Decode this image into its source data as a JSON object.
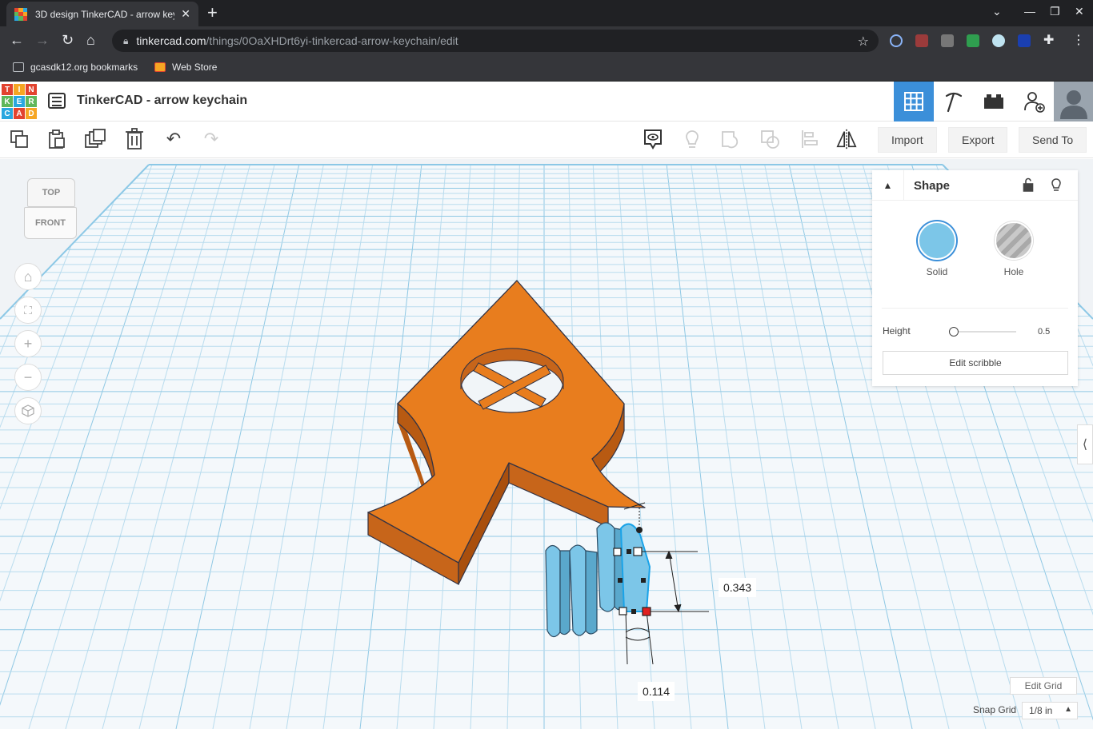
{
  "browser": {
    "tab_title": "3D design TinkerCAD - arrow key",
    "url_host": "tinkercad.com",
    "url_path": "/things/0OaXHDrt6yi-tinkercad-arrow-keychain/edit",
    "bookmarks": [
      "gcasdk12.org bookmarks",
      "Web Store"
    ]
  },
  "header": {
    "logo_letters": [
      "T",
      "I",
      "N",
      "K",
      "E",
      "R",
      "C",
      "A",
      "D"
    ],
    "design_title": "TinkerCAD - arrow keychain"
  },
  "toolbar": {
    "import_label": "Import",
    "export_label": "Export",
    "sendto_label": "Send To"
  },
  "viewcube": {
    "top_label": "TOP",
    "front_label": "FRONT"
  },
  "inspector": {
    "title": "Shape",
    "solid_label": "Solid",
    "hole_label": "Hole",
    "height_label": "Height",
    "height_value": "0.5",
    "scribble_label": "Edit scribble"
  },
  "dimensions": {
    "height": "0.343",
    "width": "0.114"
  },
  "grid_controls": {
    "edit_grid_label": "Edit Grid",
    "snap_label": "Snap Grid",
    "snap_value": "1/8 in"
  },
  "colors": {
    "shape_orange": "#e87d1e",
    "shape_orange_dark": "#b85a12",
    "scribble_blue": "#7cc6e8",
    "accent_blue": "#3b8fd9"
  }
}
